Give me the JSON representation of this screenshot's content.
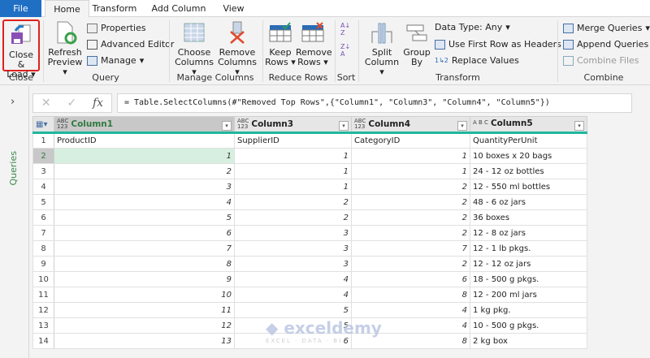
{
  "tabs": [
    "File",
    "Home",
    "Transform",
    "Add Column",
    "View"
  ],
  "ribbon": {
    "close": {
      "button": "Close &",
      "button2": "Load",
      "group": "Close"
    },
    "query": {
      "refresh": "Refresh",
      "refresh2": "Preview",
      "properties": "Properties",
      "advanced_editor": "Advanced Editor",
      "manage": "Manage",
      "group": "Query"
    },
    "manage_columns": {
      "choose": "Choose",
      "choose2": "Columns",
      "remove": "Remove",
      "remove2": "Columns",
      "group": "Manage Columns"
    },
    "reduce_rows": {
      "keep": "Keep",
      "keep2": "Rows",
      "remove": "Remove",
      "remove2": "Rows",
      "group": "Reduce Rows"
    },
    "sort": {
      "group": "Sort"
    },
    "transform": {
      "split": "Split",
      "split2": "Column",
      "group_by": "Group",
      "group_by2": "By",
      "data_type": "Data Type: Any",
      "first_row": "Use First Row as Headers",
      "replace": "Replace Values",
      "group": "Transform"
    },
    "combine": {
      "merge": "Merge Queries",
      "append": "Append Queries",
      "combine_files": "Combine Files",
      "group": "Combine"
    }
  },
  "queries_label": "Queries",
  "formula": "= Table.SelectColumns(#\"Removed Top Rows\",{\"Column1\", \"Column3\", \"Column4\", \"Column5\"})",
  "columns": [
    {
      "type": "ABC\n123",
      "name": "Column1"
    },
    {
      "type": "ABC\n123",
      "name": "Column3"
    },
    {
      "type": "ABC\n123",
      "name": "Column4"
    },
    {
      "type": "A B C",
      "name": "Column5"
    }
  ],
  "rows": [
    [
      "ProductID",
      "SupplierID",
      "CategoryID",
      "QuantityPerUnit"
    ],
    [
      "1",
      "1",
      "1",
      "10 boxes x 20 bags"
    ],
    [
      "2",
      "1",
      "1",
      "24 - 12 oz bottles"
    ],
    [
      "3",
      "1",
      "2",
      "12 - 550 ml bottles"
    ],
    [
      "4",
      "2",
      "2",
      "48 - 6 oz jars"
    ],
    [
      "5",
      "2",
      "2",
      "36 boxes"
    ],
    [
      "6",
      "3",
      "2",
      "12 - 8 oz jars"
    ],
    [
      "7",
      "3",
      "7",
      "12 - 1 lb pkgs."
    ],
    [
      "8",
      "3",
      "2",
      "12 - 12 oz jars"
    ],
    [
      "9",
      "4",
      "6",
      "18 - 500 g pkgs."
    ],
    [
      "10",
      "4",
      "8",
      "12 - 200 ml jars"
    ],
    [
      "11",
      "5",
      "4",
      "1 kg pkg."
    ],
    [
      "12",
      "5",
      "4",
      "10 - 500 g pkgs."
    ],
    [
      "13",
      "6",
      "8",
      "2 kg box"
    ]
  ],
  "watermark": {
    "name": "exceldemy",
    "tag": "EXCEL · DATA · BI"
  }
}
